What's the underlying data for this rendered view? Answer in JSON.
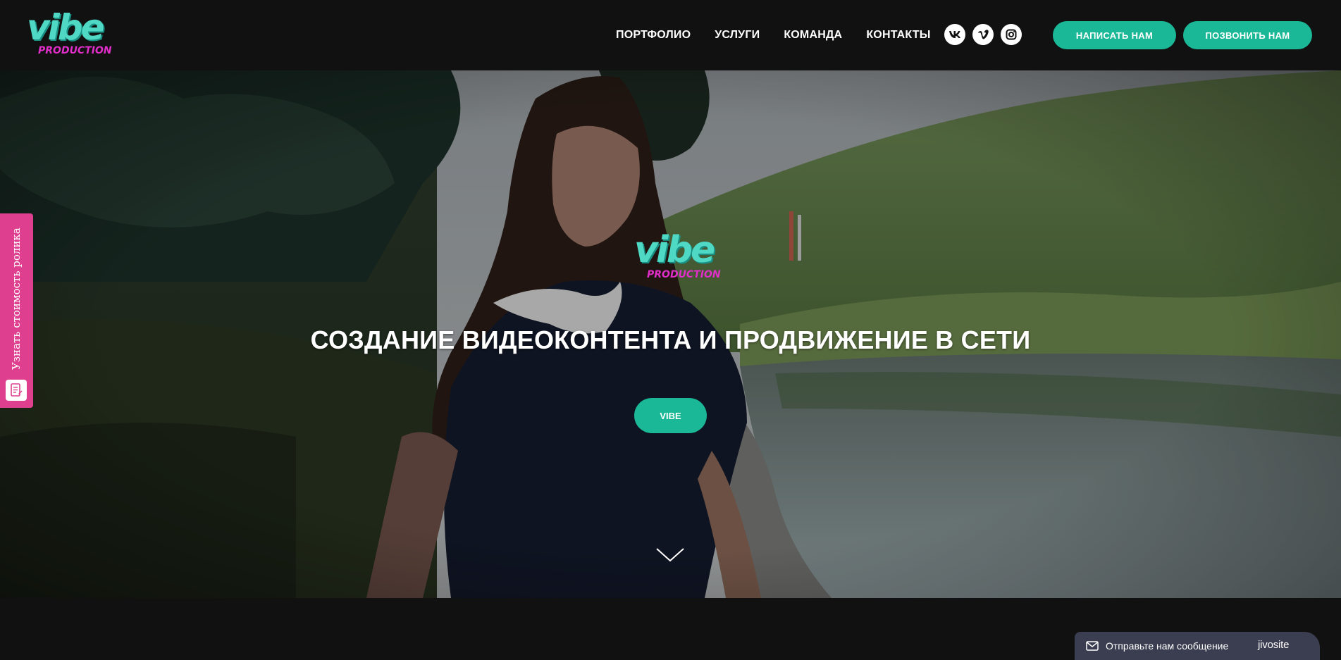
{
  "header": {
    "logo": {
      "word": "vibe",
      "sub": "PRODUCTION"
    },
    "nav": [
      {
        "label": "ПОРТФОЛИО"
      },
      {
        "label": "УСЛУГИ"
      },
      {
        "label": "КОМАНДА"
      },
      {
        "label": "КОНТАКТЫ"
      }
    ],
    "social": [
      {
        "icon": "vk-icon",
        "glyph": "vk"
      },
      {
        "icon": "vimeo-icon",
        "glyph": "v"
      },
      {
        "icon": "instagram-icon",
        "glyph": ""
      }
    ],
    "write_label": "НАПИСАТЬ НАМ",
    "call_label": "ПОЗВОНИТЬ НАМ"
  },
  "hero": {
    "logo": {
      "word": "vibe",
      "sub": "PRODUCTION"
    },
    "title": "СОЗДАНИЕ ВИДЕОКОНТЕНТА И ПРОДВИЖЕНИЕ В СЕТИ",
    "button_label": "VIBE",
    "scroll_icon": "chevron-down-icon"
  },
  "side_tab": {
    "label": "Узнать стоимость ролика",
    "icon": "form-icon"
  },
  "chat": {
    "label": "Отправьте нам сообщение",
    "brand": "jivosite",
    "icon": "mail-icon"
  },
  "colors": {
    "accent": "#1ab897",
    "logo_teal": "#4fd8c4",
    "logo_pink": "#e02ec8",
    "side_tab": "#de3f8e",
    "header_bg": "#111111",
    "chat_bg": "#3a3e50"
  }
}
